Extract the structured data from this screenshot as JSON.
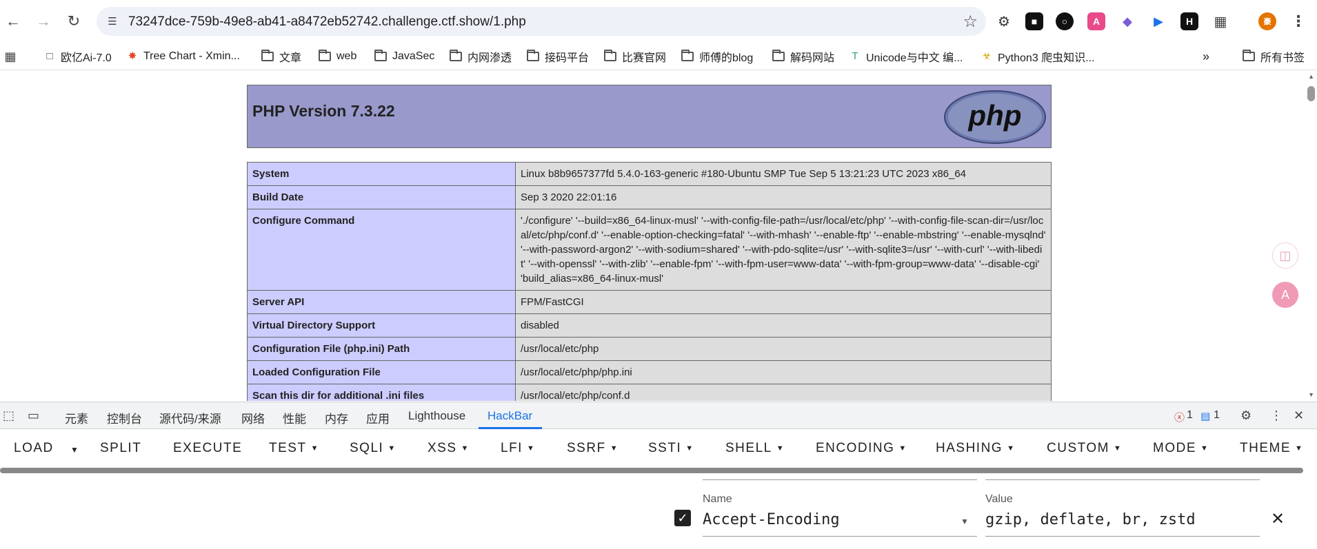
{
  "browser": {
    "url": "73247dce-759b-49e8-ab41-a8472eb52742.challenge.ctf.show/1.php",
    "profile_initial": "豪"
  },
  "bookmarks": [
    {
      "label": "欧亿Ai-7.0",
      "icon": "chat-icon"
    },
    {
      "label": "Tree Chart - Xmin...",
      "icon": "site-icon"
    },
    {
      "label": "文章",
      "icon": "folder-icon"
    },
    {
      "label": "web",
      "icon": "folder-icon"
    },
    {
      "label": "JavaSec",
      "icon": "folder-icon"
    },
    {
      "label": "内网渗透",
      "icon": "folder-icon"
    },
    {
      "label": "接码平台",
      "icon": "folder-icon"
    },
    {
      "label": "比赛官网",
      "icon": "folder-icon"
    },
    {
      "label": "师傅的blog",
      "icon": "folder-icon"
    },
    {
      "label": "解码网站",
      "icon": "folder-icon"
    },
    {
      "label": "Unicode与中文 编...",
      "icon": "site-icon"
    },
    {
      "label": "Python3 爬虫知识...",
      "icon": "site-icon"
    }
  ],
  "all_bookmarks": "所有书签",
  "phpinfo": {
    "title": "PHP Version 7.3.22",
    "logo_text": "php",
    "rows": [
      {
        "key": "System",
        "value": "Linux b8b9657377fd 5.4.0-163-generic #180-Ubuntu SMP Tue Sep 5 13:21:23 UTC 2023 x86_64"
      },
      {
        "key": "Build Date",
        "value": "Sep 3 2020 22:01:16"
      },
      {
        "key": "Configure Command",
        "value": "'./configure' '--build=x86_64-linux-musl' '--with-config-file-path=/usr/local/etc/php' '--with-config-file-scan-dir=/usr/local/etc/php/conf.d' '--enable-option-checking=fatal' '--with-mhash' '--enable-ftp' '--enable-mbstring' '--enable-mysqlnd' '--with-password-argon2' '--with-sodium=shared' '--with-pdo-sqlite=/usr' '--with-sqlite3=/usr' '--with-curl' '--with-libedit' '--with-openssl' '--with-zlib' '--enable-fpm' '--with-fpm-user=www-data' '--with-fpm-group=www-data' '--disable-cgi' 'build_alias=x86_64-linux-musl'"
      },
      {
        "key": "Server API",
        "value": "FPM/FastCGI"
      },
      {
        "key": "Virtual Directory Support",
        "value": "disabled"
      },
      {
        "key": "Configuration File (php.ini) Path",
        "value": "/usr/local/etc/php"
      },
      {
        "key": "Loaded Configuration File",
        "value": "/usr/local/etc/php/php.ini"
      },
      {
        "key": "Scan this dir for additional .ini files",
        "value": "/usr/local/etc/php/conf.d"
      }
    ]
  },
  "devtools": {
    "tabs": [
      "元素",
      "控制台",
      "源代码/来源",
      "网络",
      "性能",
      "内存",
      "应用",
      "Lighthouse",
      "HackBar"
    ],
    "active_tab": "HackBar",
    "error_count": "1",
    "message_count": "1"
  },
  "hackbar": {
    "buttons": [
      "LOAD",
      "SPLIT",
      "EXECUTE",
      "TEST",
      "SQLI",
      "XSS",
      "LFI",
      "SSRF",
      "SSTI",
      "SHELL",
      "ENCODING",
      "HASHING",
      "CUSTOM",
      "MODE",
      "THEME"
    ],
    "header": {
      "name_label": "Name",
      "name_value": "Accept-Encoding",
      "value_label": "Value",
      "value_value": "gzip, deflate, br, zstd",
      "enabled": true
    }
  }
}
